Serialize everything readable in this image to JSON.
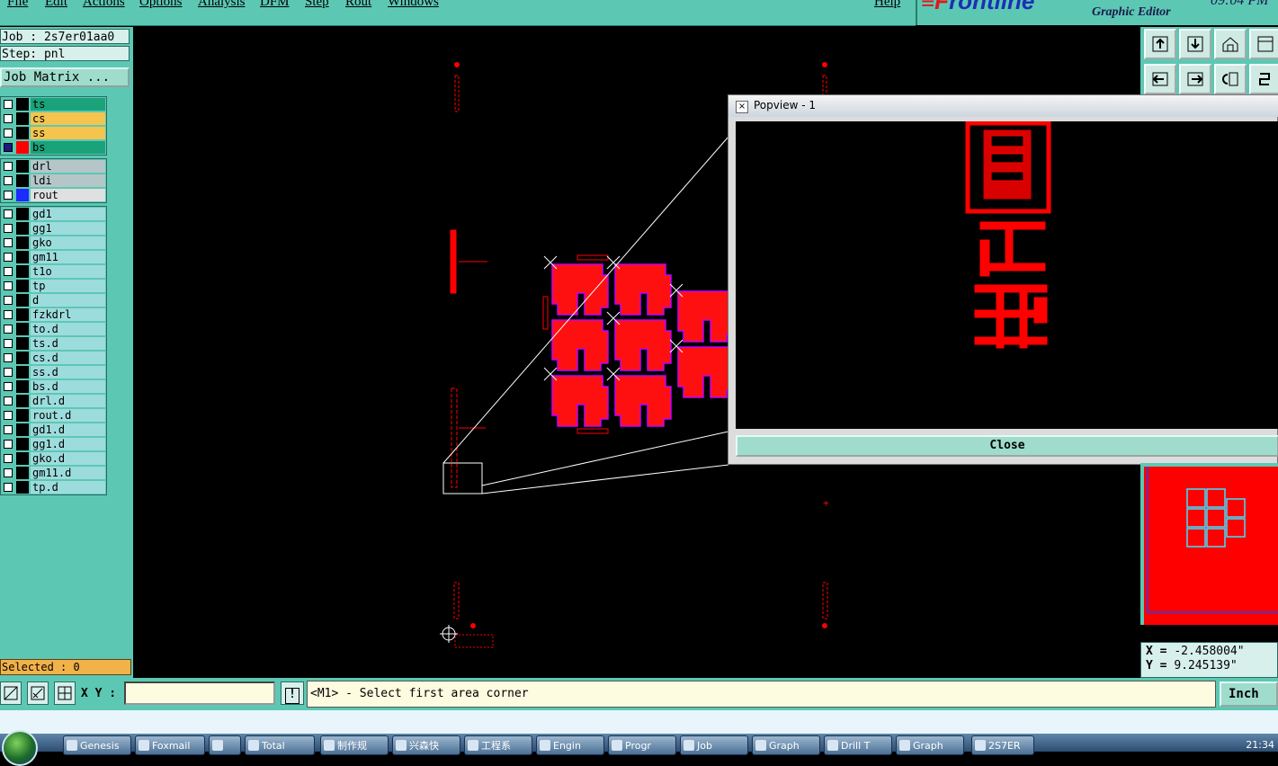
{
  "menu": {
    "items": [
      "File",
      "Edit",
      "Actions",
      "Options",
      "Analysis",
      "DFM",
      "Step",
      "Rout",
      "Windows"
    ],
    "help": "Help"
  },
  "brand": {
    "logo_accent": "≡F",
    "logo_main": "rontline",
    "subtitle": "Graphic Editor",
    "clock": "09:04 PM"
  },
  "job": {
    "job_label": "Job : 2s7er01aa0",
    "step_label": "Step: pnl",
    "matrix_button": "Job Matrix ..."
  },
  "layers": {
    "group1": [
      {
        "name": "ts",
        "bg": "#1aa37a",
        "checked": false,
        "color": "#000000"
      },
      {
        "name": "cs",
        "bg": "#f5c44e",
        "checked": false,
        "color": "#000000"
      },
      {
        "name": "ss",
        "bg": "#f5c44e",
        "checked": false,
        "color": "#000000"
      },
      {
        "name": "bs",
        "bg": "#1aa37a",
        "checked": true,
        "color": "#ff0000"
      }
    ],
    "group2": [
      {
        "name": "drl",
        "bg": "#b5c6c8",
        "checked": false,
        "color": "#000000"
      },
      {
        "name": "ldi",
        "bg": "#b5c6c8",
        "checked": false,
        "color": "#000000"
      },
      {
        "name": "rout",
        "bg": "#e0e0e0",
        "checked": false,
        "color": "#1c2bff"
      }
    ],
    "group3": [
      "gd1",
      "gg1",
      "gko",
      "gm11",
      "t1o",
      "tp",
      "d",
      "fzkdrl",
      "to.d",
      "ts.d",
      "cs.d",
      "ss.d",
      "bs.d",
      "drl.d",
      "rout.d",
      "gd1.d",
      "gg1.d",
      "gko.d",
      "gm11.d",
      "tp.d"
    ]
  },
  "selected": "Selected : 0",
  "popview": {
    "title": "Popview - 1",
    "close_label": "Close"
  },
  "coords": {
    "x_label": "X = ",
    "x_value": "-2.458004\"",
    "y_label": "Y = ",
    "y_value": "9.245139\""
  },
  "bottombar": {
    "xy_label": "X Y :",
    "xy_value": "",
    "warn_label": "!",
    "prompt": "<M1> - Select first area corner",
    "units": "Inch"
  },
  "taskbar": {
    "items": [
      "Genesis",
      "Foxmail",
      "",
      "Total",
      "制作规",
      "兴森快",
      "工程系",
      "Engin",
      "Progr",
      "Job",
      "Graph",
      "Drill T",
      "Graph",
      "2S7ER"
    ],
    "clock": "21:34"
  },
  "colors": {
    "panel": "#5cc8b4",
    "copper": "#ff0000",
    "outline": "#b000ff",
    "canvas": "#000000"
  }
}
